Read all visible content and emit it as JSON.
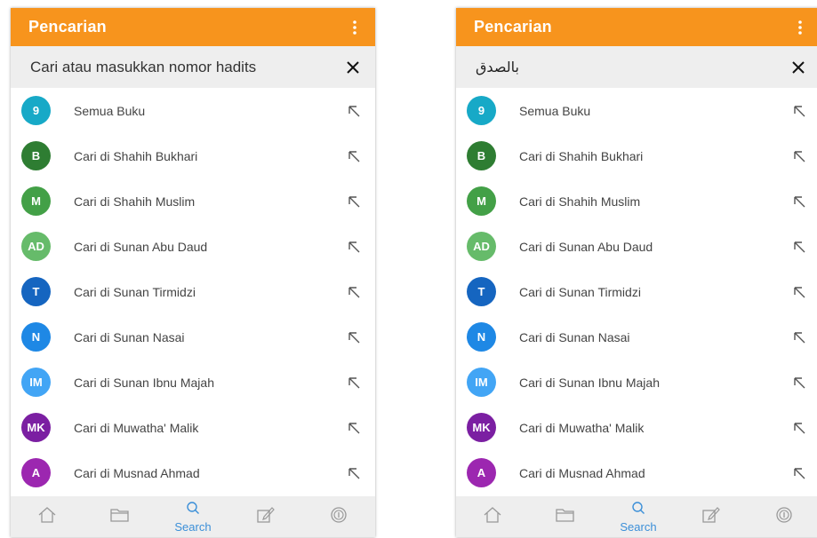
{
  "appbar": {
    "title": "Pencarian"
  },
  "search_left": {
    "placeholder": "Cari atau masukkan nomor hadits",
    "value": ""
  },
  "search_right": {
    "value": "بالصدق"
  },
  "books": [
    {
      "badge": "9",
      "label": "Semua Buku",
      "color": "#17a9c7"
    },
    {
      "badge": "B",
      "label": "Cari di Shahih Bukhari",
      "color": "#2e7d32"
    },
    {
      "badge": "M",
      "label": "Cari di Shahih Muslim",
      "color": "#43a047"
    },
    {
      "badge": "AD",
      "label": "Cari di Sunan Abu Daud",
      "color": "#66bb6a"
    },
    {
      "badge": "T",
      "label": "Cari di Sunan Tirmidzi",
      "color": "#1565c0"
    },
    {
      "badge": "N",
      "label": "Cari di Sunan Nasai",
      "color": "#1e88e5"
    },
    {
      "badge": "IM",
      "label": "Cari di Sunan Ibnu Majah",
      "color": "#42a5f5"
    },
    {
      "badge": "MK",
      "label": "Cari di Muwatha' Malik",
      "color": "#7b1fa2"
    },
    {
      "badge": "A",
      "label": "Cari di Musnad Ahmad",
      "color": "#9c27b0"
    }
  ],
  "nav": {
    "items": [
      "home-icon",
      "folder-icon",
      "search-icon",
      "edit-icon",
      "info-icon"
    ],
    "active_label": "Search"
  },
  "colors": {
    "accent": "#f7941d",
    "active": "#3b8fd8",
    "icon": "#999999"
  }
}
